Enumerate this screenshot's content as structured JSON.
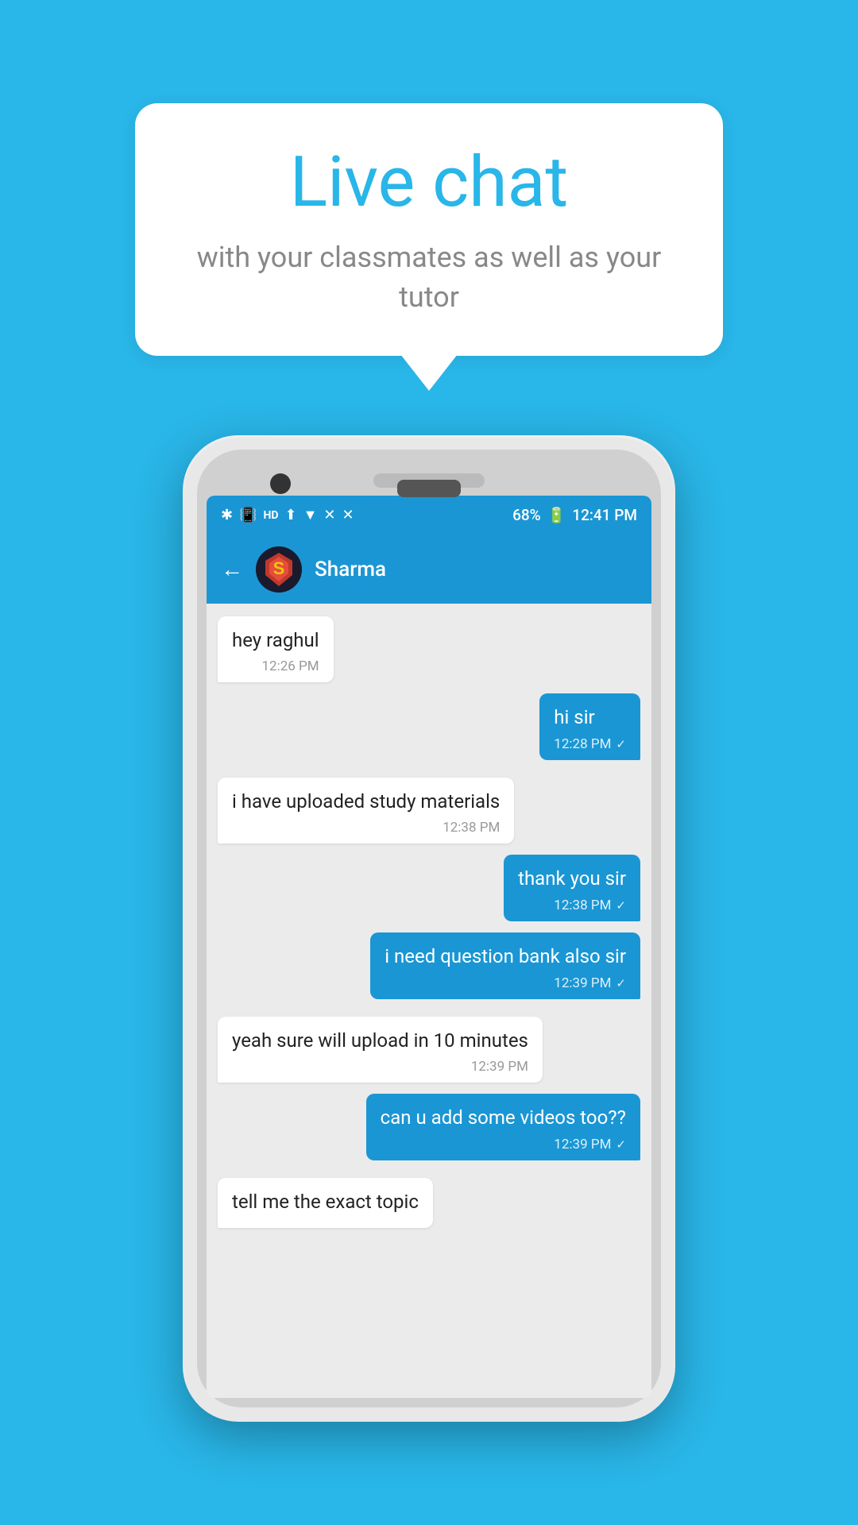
{
  "background_color": "#29b6e8",
  "bubble": {
    "title": "Live chat",
    "subtitle": "with your classmates as well as your tutor"
  },
  "status_bar": {
    "time": "12:41 PM",
    "battery": "68%",
    "signal_icons": "bluetooth vibrate HD wifi signal cross"
  },
  "chat_header": {
    "contact_name": "Sharma",
    "back_label": "←",
    "avatar_icon": "superman"
  },
  "messages": [
    {
      "id": "msg1",
      "type": "received",
      "text": "hey raghul",
      "time": "12:26 PM",
      "tick": null
    },
    {
      "id": "msg2",
      "type": "sent",
      "text": "hi sir",
      "time": "12:28 PM",
      "tick": "✓"
    },
    {
      "id": "msg3",
      "type": "received",
      "text": "i have uploaded study materials",
      "time": "12:38 PM",
      "tick": null
    },
    {
      "id": "msg4",
      "type": "sent",
      "text": "thank you sir",
      "time": "12:38 PM",
      "tick": "✓"
    },
    {
      "id": "msg5",
      "type": "sent",
      "text": "i need question bank also sir",
      "time": "12:39 PM",
      "tick": "✓"
    },
    {
      "id": "msg6",
      "type": "received",
      "text": "yeah sure will upload in 10 minutes",
      "time": "12:39 PM",
      "tick": null
    },
    {
      "id": "msg7",
      "type": "sent",
      "text": "can u add some videos too??",
      "time": "12:39 PM",
      "tick": "✓"
    },
    {
      "id": "msg8",
      "type": "received",
      "text": "tell me the exact topic",
      "time": "",
      "tick": null,
      "partial": true
    }
  ]
}
